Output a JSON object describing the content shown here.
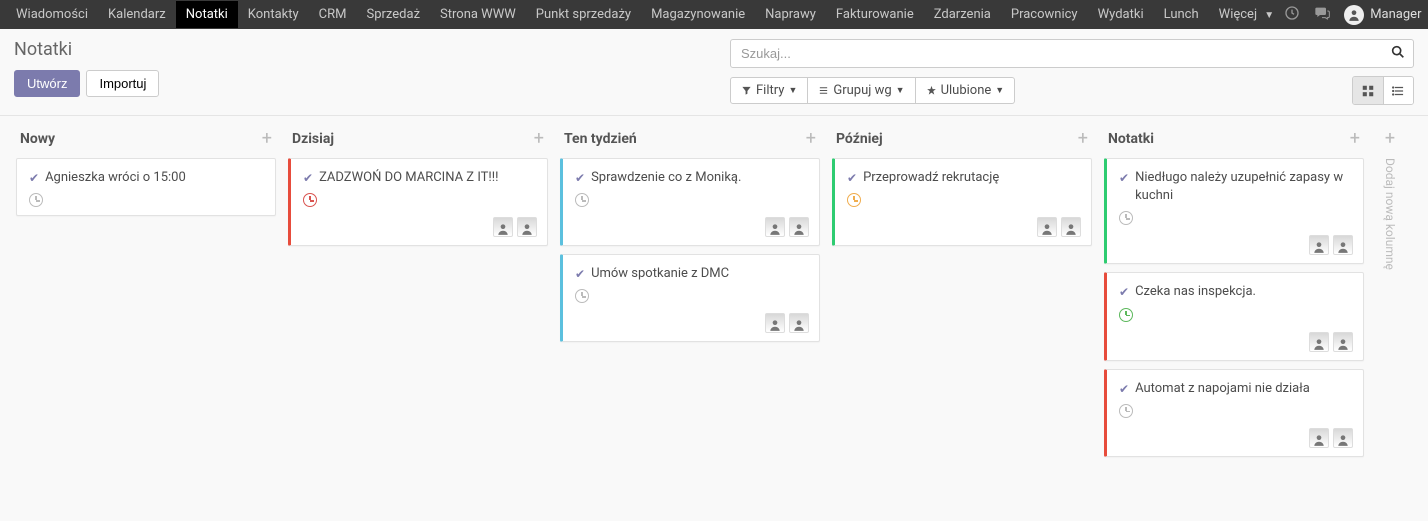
{
  "nav": {
    "items": [
      {
        "label": "Wiadomości"
      },
      {
        "label": "Kalendarz"
      },
      {
        "label": "Notatki",
        "active": true
      },
      {
        "label": "Kontakty"
      },
      {
        "label": "CRM"
      },
      {
        "label": "Sprzedaż"
      },
      {
        "label": "Strona WWW"
      },
      {
        "label": "Punkt sprzedaży"
      },
      {
        "label": "Magazynowanie"
      },
      {
        "label": "Naprawy"
      },
      {
        "label": "Fakturowanie"
      },
      {
        "label": "Zdarzenia"
      },
      {
        "label": "Pracownicy"
      },
      {
        "label": "Wydatki"
      },
      {
        "label": "Lunch"
      },
      {
        "label": "Więcej",
        "hasCaret": true
      }
    ],
    "user_name": "Manager"
  },
  "header": {
    "title": "Notatki",
    "create_btn": "Utwórz",
    "import_btn": "Importuj"
  },
  "search": {
    "placeholder": "Szukaj..."
  },
  "toolbar": {
    "filters": "Filtry",
    "groupby": "Grupuj wg",
    "favorites": "Ulubione"
  },
  "kanban": {
    "add_column_label": "Dodaj nową kolumnę",
    "columns": [
      {
        "title": "Nowy",
        "cards": [
          {
            "title": "Agnieszka wróci o 15:00",
            "clock": "grey",
            "accent": "",
            "avatars": 0
          }
        ]
      },
      {
        "title": "Dzisiaj",
        "cards": [
          {
            "title": "ZADZWOŃ DO MARCINA Z IT!!!",
            "clock": "red",
            "accent": "red",
            "avatars": 2
          }
        ]
      },
      {
        "title": "Ten tydzień",
        "cards": [
          {
            "title": "Sprawdzenie co z Moniką.",
            "clock": "grey",
            "accent": "blue",
            "avatars": 2
          },
          {
            "title": "Umów spotkanie z DMC",
            "clock": "grey",
            "accent": "blue",
            "avatars": 2
          }
        ]
      },
      {
        "title": "Później",
        "cards": [
          {
            "title": "Przeprowadź rekrutację",
            "clock": "orange",
            "accent": "green",
            "avatars": 2
          }
        ]
      },
      {
        "title": "Notatki",
        "cards": [
          {
            "title": "Niedługo należy uzupełnić zapasy w kuchni",
            "clock": "grey",
            "accent": "green",
            "avatars": 2
          },
          {
            "title": "Czeka nas inspekcja.",
            "clock": "green",
            "accent": "red",
            "avatars": 2
          },
          {
            "title": "Automat z napojami nie działa",
            "clock": "grey",
            "accent": "red",
            "avatars": 2
          }
        ]
      }
    ]
  }
}
